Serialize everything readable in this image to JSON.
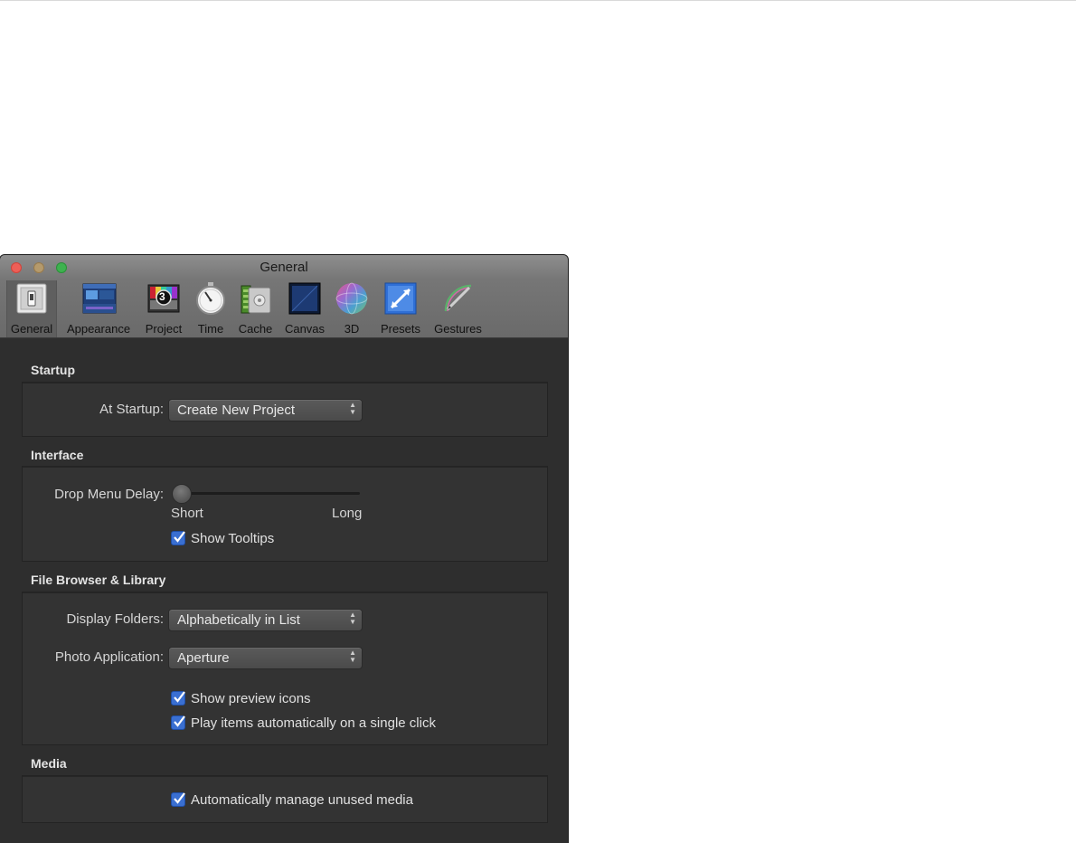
{
  "window": {
    "title": "General"
  },
  "toolbar": {
    "tabs": [
      {
        "label": "General",
        "icon": "general-switch-icon"
      },
      {
        "label": "Appearance",
        "icon": "appearance-icon"
      },
      {
        "label": "Project",
        "icon": "project-icon"
      },
      {
        "label": "Time",
        "icon": "stopwatch-icon"
      },
      {
        "label": "Cache",
        "icon": "cache-icon"
      },
      {
        "label": "Canvas",
        "icon": "canvas-icon"
      },
      {
        "label": "3D",
        "icon": "sphere-3d-icon"
      },
      {
        "label": "Presets",
        "icon": "presets-icon"
      },
      {
        "label": "Gestures",
        "icon": "gestures-pen-icon"
      }
    ],
    "project_icon_number": "3",
    "selected": "General"
  },
  "startup": {
    "section_title": "Startup",
    "at_startup_label": "At Startup:",
    "at_startup_value": "Create New Project"
  },
  "interface": {
    "section_title": "Interface",
    "drop_menu_delay_label": "Drop Menu Delay:",
    "slider_min_label": "Short",
    "slider_max_label": "Long",
    "slider_value": 0,
    "show_tooltips_label": "Show Tooltips",
    "show_tooltips_checked": true
  },
  "file_browser": {
    "section_title": "File Browser & Library",
    "display_folders_label": "Display Folders:",
    "display_folders_value": "Alphabetically in List",
    "photo_app_label": "Photo Application:",
    "photo_app_value": "Aperture",
    "show_preview_icons_label": "Show preview icons",
    "show_preview_icons_checked": true,
    "play_items_label": "Play items automatically on a single click",
    "play_items_checked": true
  },
  "media": {
    "section_title": "Media",
    "manage_unused_label": "Automatically manage unused media",
    "manage_unused_checked": true
  },
  "colors": {
    "content_background": "#2e2e2e",
    "checkbox_accent": "#3a6fd1",
    "close_button": "#ee5f57"
  }
}
